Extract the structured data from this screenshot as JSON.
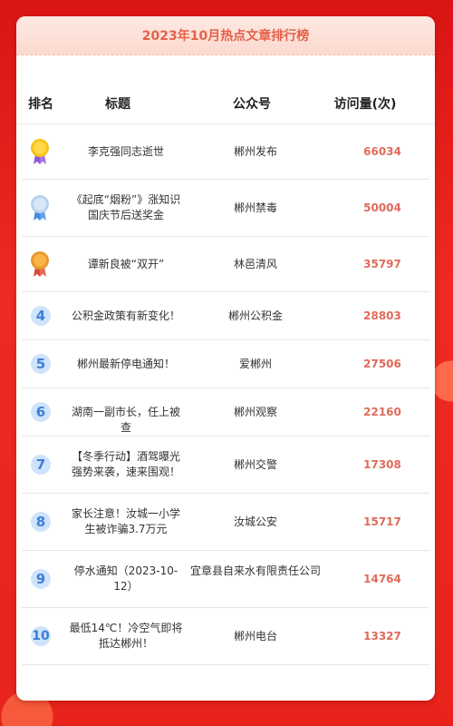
{
  "title": "2023年10月热点文章排行榜",
  "colors": {
    "background": "#e8231e",
    "title_text": "#e5604a",
    "visits_text": "#e06a5a",
    "rank_badge_bg": "#cfe3fb",
    "rank_badge_text": "#3d7fd6"
  },
  "table": {
    "headers": [
      "排名",
      "标题",
      "公众号",
      "访问量(次)"
    ],
    "rows": [
      {
        "rank": "1",
        "medal": "gold-medal-icon",
        "title": "李克强同志逝世",
        "account": "郴州发布",
        "visits": "66034"
      },
      {
        "rank": "2",
        "medal": "silver-medal-icon",
        "title": "《起底“烟粉”》涨知识 国庆节后送奖金",
        "account": "郴州禁毒",
        "visits": "50004"
      },
      {
        "rank": "3",
        "medal": "bronze-medal-icon",
        "title": "谭新良被“双开”",
        "account": "林邑清风",
        "visits": "35797"
      },
      {
        "rank": "4",
        "title": "公积金政策有新变化！",
        "account": "郴州公积金",
        "visits": "28803"
      },
      {
        "rank": "5",
        "title": "郴州最新停电通知！",
        "account": "爱郴州",
        "visits": "27506"
      },
      {
        "rank": "6",
        "title": "湖南一副市长，任上被查",
        "account": "郴州观察",
        "visits": "22160"
      },
      {
        "rank": "7",
        "title": "【冬季行动】酒驾曝光强势来袭，速来围观！",
        "account": "郴州交警",
        "visits": "17308"
      },
      {
        "rank": "8",
        "title": "家长注意！汝城一小学生被诈骗3.7万元",
        "account": "汝城公安",
        "visits": "15717"
      },
      {
        "rank": "9",
        "title": "停水通知（2023-10-12）",
        "account": "宜章县自来水有限责任公司",
        "visits": "14764"
      },
      {
        "rank": "10",
        "title": "最低14℃！冷空气即将抵达郴州！",
        "account": "郴州电台",
        "visits": "13327"
      }
    ]
  }
}
